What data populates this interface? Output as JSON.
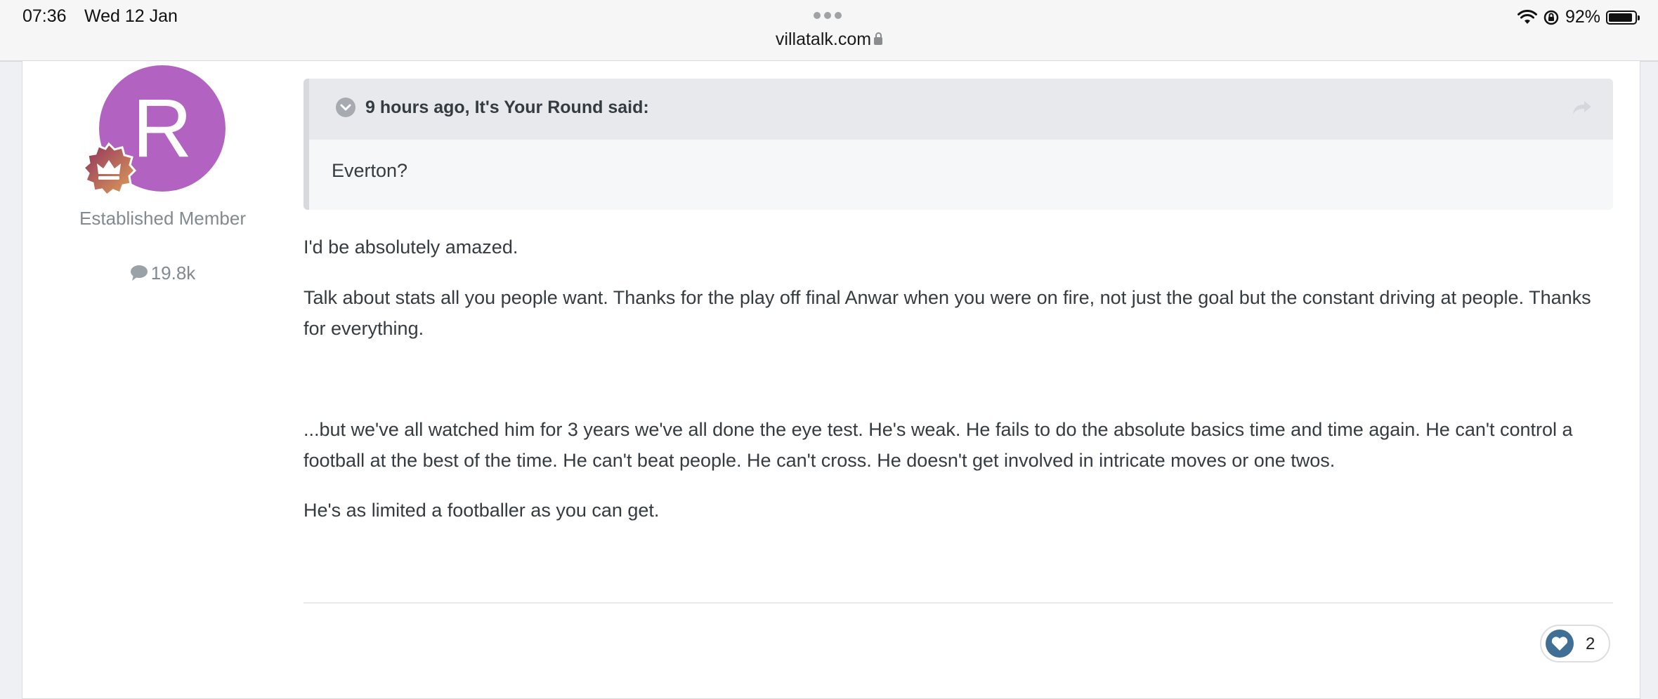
{
  "status_bar": {
    "time": "07:36",
    "date": "Wed 12 Jan",
    "url": "villatalk.com",
    "battery": "92%",
    "battery_level": 0.92,
    "icons": [
      "dots-icon",
      "lock-icon",
      "wifi-icon",
      "rotation-lock-icon",
      "battery-icon"
    ]
  },
  "author": {
    "avatar_letter": "R",
    "avatar_color": "#b262c0",
    "rank_badge_icon": "crown-icon",
    "member_title": "Established Member",
    "post_count": "19.8k"
  },
  "quote": {
    "citation": "9 hours ago, It's Your Round said:",
    "text": "Everton?"
  },
  "post": {
    "paragraphs": [
      "I'd be absolutely amazed.",
      "Talk about stats all you people want. Thanks for the play off final Anwar when you were on fire, not just the goal but the constant driving at people. Thanks for everything.",
      "...but we've all watched him for 3 years we've all done the eye test. He's weak. He fails to do the absolute basics time and time again. He can't control a football at the best of the time. He can't beat people. He can't cross. He doesn't get involved in intricate moves or one twos.",
      "He's as limited a footballer as you can get."
    ]
  },
  "reactions": {
    "icon": "heart-icon",
    "count": "2"
  },
  "colors": {
    "accent": "#3f6f94",
    "avatar": "#b262c0",
    "text": "#353c41"
  }
}
